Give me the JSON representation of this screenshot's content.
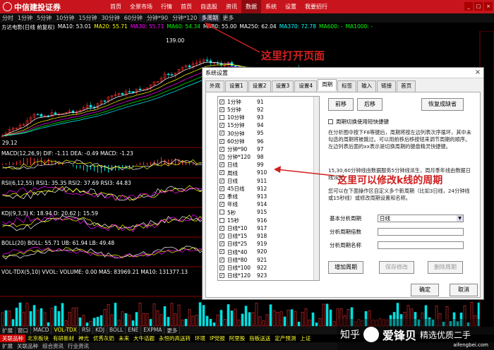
{
  "app": {
    "logo_text": "中信建投证券",
    "menu": [
      "首页",
      "全景市场",
      "行情",
      "首页",
      "自选股",
      "资讯",
      "数据",
      "系统",
      "设置",
      "我要招行"
    ],
    "menu_active": 6
  },
  "period_bar": {
    "items": [
      "分时",
      "1分钟",
      "5分钟",
      "10分钟",
      "15分钟",
      "30分钟",
      "60分钟",
      "分钟*90",
      "分钟*120",
      "多周期",
      "更多"
    ],
    "selected": 9
  },
  "info_line": {
    "title": "方达电影(日线 前复权)",
    "items": [
      {
        "text": "MA10: 53.01",
        "color": "#ffffff"
      },
      {
        "text": "MA20: 55.71",
        "color": "#ffff00"
      },
      {
        "text": "MA30: 55.71",
        "color": "#ff00ff"
      },
      {
        "text": "MA60: 54.34",
        "color": "#00ff00"
      },
      {
        "text": "MA80: 55.00",
        "color": "#ffffff"
      },
      {
        "text": "MA250: 62.04",
        "color": "#ffffff"
      },
      {
        "text": "MA370: 72.78",
        "color": "#00ffff"
      },
      {
        "text": "MA600: -",
        "color": "#00ff00"
      },
      {
        "text": "MA1000: -",
        "color": "#00ff00"
      }
    ]
  },
  "price_labels": {
    "high": "139.00",
    "low": "29.12"
  },
  "indicators": {
    "macd": "MACD(12,26,9) DIF: -1.11 DEA: -0.49 MACD: -1.23",
    "rsi": "RSI(6,12,55) RSI1: 35.35 RSI2: 37.69 RSI3: 44.83",
    "kdj": "KDJ(9,3,3) K: 18.94 D: 20.62 J: 15.59",
    "boll": "BOLL(20) BOLL: 55.71 UB: 61.94 LB: 49.48",
    "vol": "VOL-TDX(5,10) VVOL: VOLUME: 0.00 MA5: 83969.21 MA10: 131377.13"
  },
  "annotations": {
    "open": "这里打开页面",
    "modify": "这里可以修改k线的周期"
  },
  "dialog": {
    "title": "系统设置",
    "tabs": [
      "外观",
      "设置1",
      "设置2",
      "设置3",
      "设置4",
      "周期",
      "标签",
      "输入",
      "链接",
      "首页"
    ],
    "active_tab": 5,
    "periods": [
      {
        "name": "1分钟",
        "code": "91",
        "checked": true
      },
      {
        "name": "5分钟",
        "code": "92",
        "checked": true
      },
      {
        "name": "10分钟",
        "code": "93",
        "checked": false
      },
      {
        "name": "15分钟",
        "code": "94",
        "checked": true
      },
      {
        "name": "30分钟",
        "code": "95",
        "checked": true
      },
      {
        "name": "60分钟",
        "code": "96",
        "checked": true
      },
      {
        "name": "分钟*90",
        "code": "97",
        "checked": true
      },
      {
        "name": "分钟*120",
        "code": "98",
        "checked": true
      },
      {
        "name": "日线",
        "code": "99",
        "checked": true
      },
      {
        "name": "周线",
        "code": "910",
        "checked": true
      },
      {
        "name": "日线",
        "code": "911",
        "checked": true
      },
      {
        "name": "45日线",
        "code": "912",
        "checked": true
      },
      {
        "name": "季线",
        "code": "913",
        "checked": true
      },
      {
        "name": "年线",
        "code": "914",
        "checked": true
      },
      {
        "name": "5秒",
        "code": "915",
        "checked": false
      },
      {
        "name": "15秒",
        "code": "916",
        "checked": false
      },
      {
        "name": "日线*10",
        "code": "917",
        "checked": true
      },
      {
        "name": "日线*15",
        "code": "918",
        "checked": true
      },
      {
        "name": "日线*25",
        "code": "919",
        "checked": true
      },
      {
        "name": "日线*40",
        "code": "920",
        "checked": true
      },
      {
        "name": "日线*80",
        "code": "921",
        "checked": true
      },
      {
        "name": "日线*100",
        "code": "922",
        "checked": true
      },
      {
        "name": "日线*120",
        "code": "923",
        "checked": true
      }
    ],
    "buttons": {
      "prev": "前移",
      "next": "后移",
      "restore": "恢复成缺省",
      "add": "增加周期",
      "save": "保存修改",
      "delete": "删除周期",
      "ok": "确定",
      "cancel": "取消"
    },
    "cycle_checkbox": "周期切换使用短快捷键",
    "desc1": "在分析图中按下F8等键后，周期将按左边列表次序循环，其中未勾选的周期将被跳过。可以用前移后移按钮来调节周期的顺序。左边列表后面的xx表示是切换周期的键盘精灵快捷键。",
    "desc2": "15,30,60分钟线由数据服务5分钟线派生，周月季年线由数据日线派生，",
    "desc3": "您可以在下面操作区自定义多个新周期（比如3日线，24分钟线或15秒线）或修改周期设置和名称。",
    "fields": {
      "base_label": "基本分析周期",
      "base_value": "日线",
      "count_label": "分析周期倍数",
      "count_value": "",
      "name_label": "分析周期名称",
      "name_value": ""
    }
  },
  "bottom_tabs": {
    "items": [
      "扩展",
      "窗口",
      "MACD",
      "VOL-TDX",
      "RSI",
      "KDJ",
      "BOLL",
      "ENE",
      "EXPMA",
      "更多"
    ],
    "selected": 3
  },
  "ticker": [
    "关联品种",
    "北京板块",
    "有研新材",
    "神光",
    "优秀灰奶",
    "未来",
    "大牛话题",
    "永恒的高送转",
    "环境",
    "IP党报",
    "阿里股",
    "指板送送",
    "定产预测",
    "上证"
  ],
  "statusbar": [
    "扩展",
    "关联品种",
    "综合资讯",
    "行业资讯"
  ],
  "watermark": {
    "platform": "知乎",
    "brand": "爱锋贝",
    "tagline": "精选优质二手",
    "url": "aifengbei.com"
  }
}
